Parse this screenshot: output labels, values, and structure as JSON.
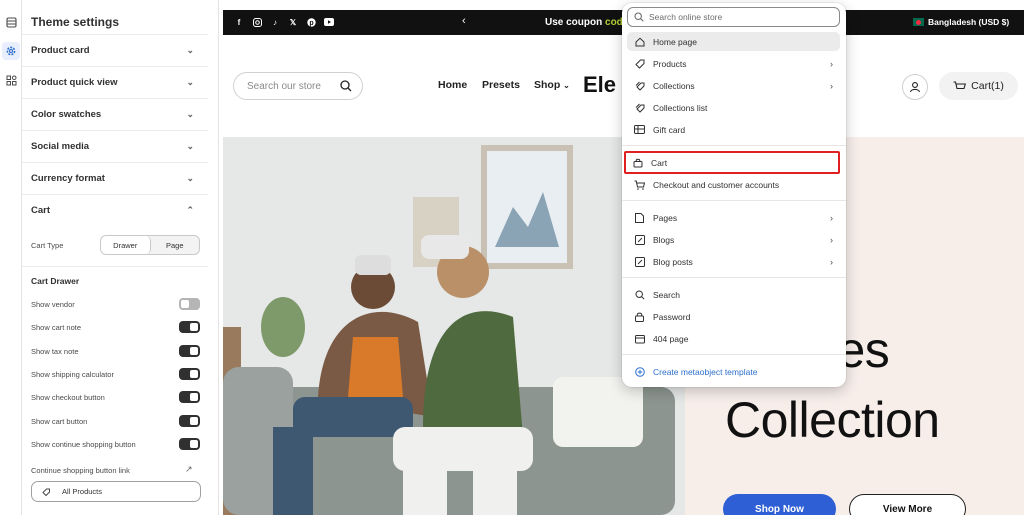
{
  "panel": {
    "title": "Theme settings",
    "sections": [
      {
        "label": "Product card"
      },
      {
        "label": "Product quick view"
      },
      {
        "label": "Color swatches"
      },
      {
        "label": "Social media"
      },
      {
        "label": "Currency format"
      },
      {
        "label": "Cart"
      }
    ],
    "cart": {
      "type_label": "Cart Type",
      "type_options": [
        "Drawer",
        "Page"
      ],
      "type_selected": "Drawer",
      "drawer_heading": "Cart Drawer",
      "toggles": [
        {
          "label": "Show vendor",
          "on": false
        },
        {
          "label": "Show cart note",
          "on": true
        },
        {
          "label": "Show tax note",
          "on": true
        },
        {
          "label": "Show shipping calculator",
          "on": true
        },
        {
          "label": "Show checkout button",
          "on": true
        },
        {
          "label": "Show cart button",
          "on": true
        },
        {
          "label": "Show continue shopping button",
          "on": true
        }
      ],
      "continue_link_label": "Continue shopping button link",
      "continue_link_value": "All Products"
    }
  },
  "store": {
    "announcement": {
      "prefix": "Use coupon",
      "code": "code"
    },
    "country": "Bangladesh (USD $)",
    "search_placeholder": "Search our store",
    "nav": [
      "Home",
      "Presets",
      "Shop"
    ],
    "logo_text": "Ele",
    "cart_label": "Cart(1)",
    "hero": {
      "line1": "ces",
      "line2": "Collection",
      "primary_button": "Shop Now",
      "secondary_button": "View More"
    }
  },
  "template_menu": {
    "search_placeholder": "Search online store",
    "groups": [
      [
        {
          "label": "Home page",
          "icon": "home-icon",
          "submenu": false,
          "highlighted": true
        },
        {
          "label": "Products",
          "icon": "tag-icon",
          "submenu": true
        },
        {
          "label": "Collections",
          "icon": "collection-icon",
          "submenu": true
        },
        {
          "label": "Collections list",
          "icon": "collection-list-icon",
          "submenu": false
        },
        {
          "label": "Gift card",
          "icon": "gift-card-icon",
          "submenu": false
        }
      ],
      [
        {
          "label": "Cart",
          "icon": "bag-icon",
          "submenu": false,
          "selected": true
        },
        {
          "label": "Checkout and customer accounts",
          "icon": "cart-icon",
          "submenu": false
        }
      ],
      [
        {
          "label": "Pages",
          "icon": "page-icon",
          "submenu": true
        },
        {
          "label": "Blogs",
          "icon": "blog-icon",
          "submenu": true
        },
        {
          "label": "Blog posts",
          "icon": "blog-post-icon",
          "submenu": true
        }
      ],
      [
        {
          "label": "Search",
          "icon": "search-icon",
          "submenu": false
        },
        {
          "label": "Password",
          "icon": "lock-icon",
          "submenu": false
        },
        {
          "label": "404 page",
          "icon": "box-icon",
          "submenu": false
        }
      ],
      [
        {
          "label": "Create metaobject template",
          "icon": "plus-circle-icon",
          "submenu": false,
          "accent": true
        }
      ]
    ]
  },
  "colors": {
    "accent": "#2f5fd4",
    "selection_outline": "#e02020",
    "coupon_code": "#b5d334"
  }
}
